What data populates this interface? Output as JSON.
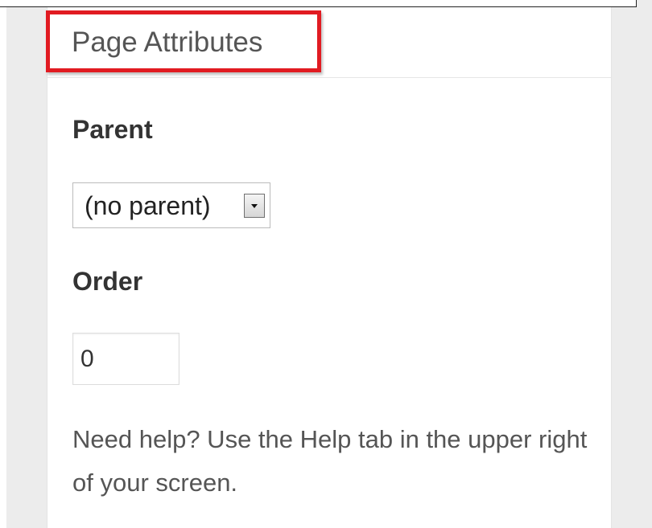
{
  "panel": {
    "title": "Page Attributes",
    "parent_label": "Parent",
    "parent_select_value": "(no parent)",
    "order_label": "Order",
    "order_value": "0",
    "help_text": "Need help? Use the Help tab in the upper right of your screen."
  },
  "colors": {
    "highlight": "#e11b22",
    "background": "#ececec",
    "panel": "#ffffff"
  },
  "icons": {
    "select_arrow": "chevron-down-icon"
  }
}
